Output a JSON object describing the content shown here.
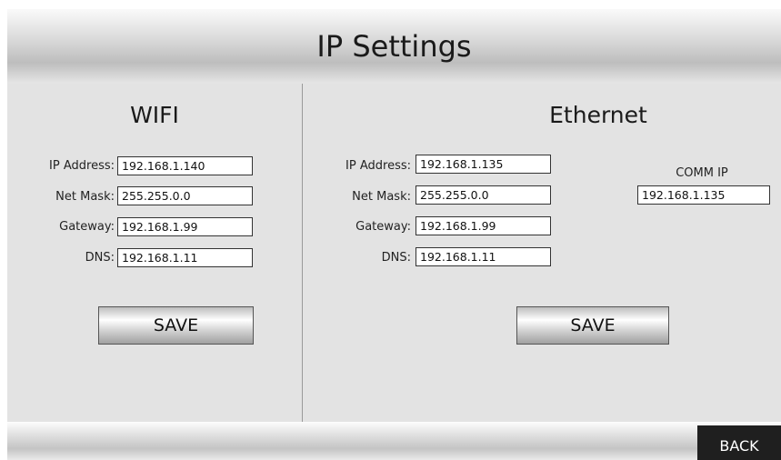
{
  "header": {
    "title": "IP Settings"
  },
  "wifi": {
    "title": "WIFI",
    "fields": [
      {
        "label": "IP Address:",
        "value": "192.168.1.140"
      },
      {
        "label": "Net Mask:",
        "value": "255.255.0.0"
      },
      {
        "label": "Gateway:",
        "value": "192.168.1.99"
      },
      {
        "label": "DNS:",
        "value": "192.168.1.11"
      }
    ],
    "save_label": "SAVE"
  },
  "ethernet": {
    "title": "Ethernet",
    "fields": [
      {
        "label": "IP Address:",
        "value": "192.168.1.135"
      },
      {
        "label": "Net Mask:",
        "value": "255.255.0.0"
      },
      {
        "label": "Gateway:",
        "value": "192.168.1.99"
      },
      {
        "label": "DNS:",
        "value": "192.168.1.11"
      }
    ],
    "comm_ip": {
      "label": "COMM IP",
      "value": "192.168.1.135"
    },
    "save_label": "SAVE"
  },
  "footer": {
    "back_label": "BACK"
  }
}
